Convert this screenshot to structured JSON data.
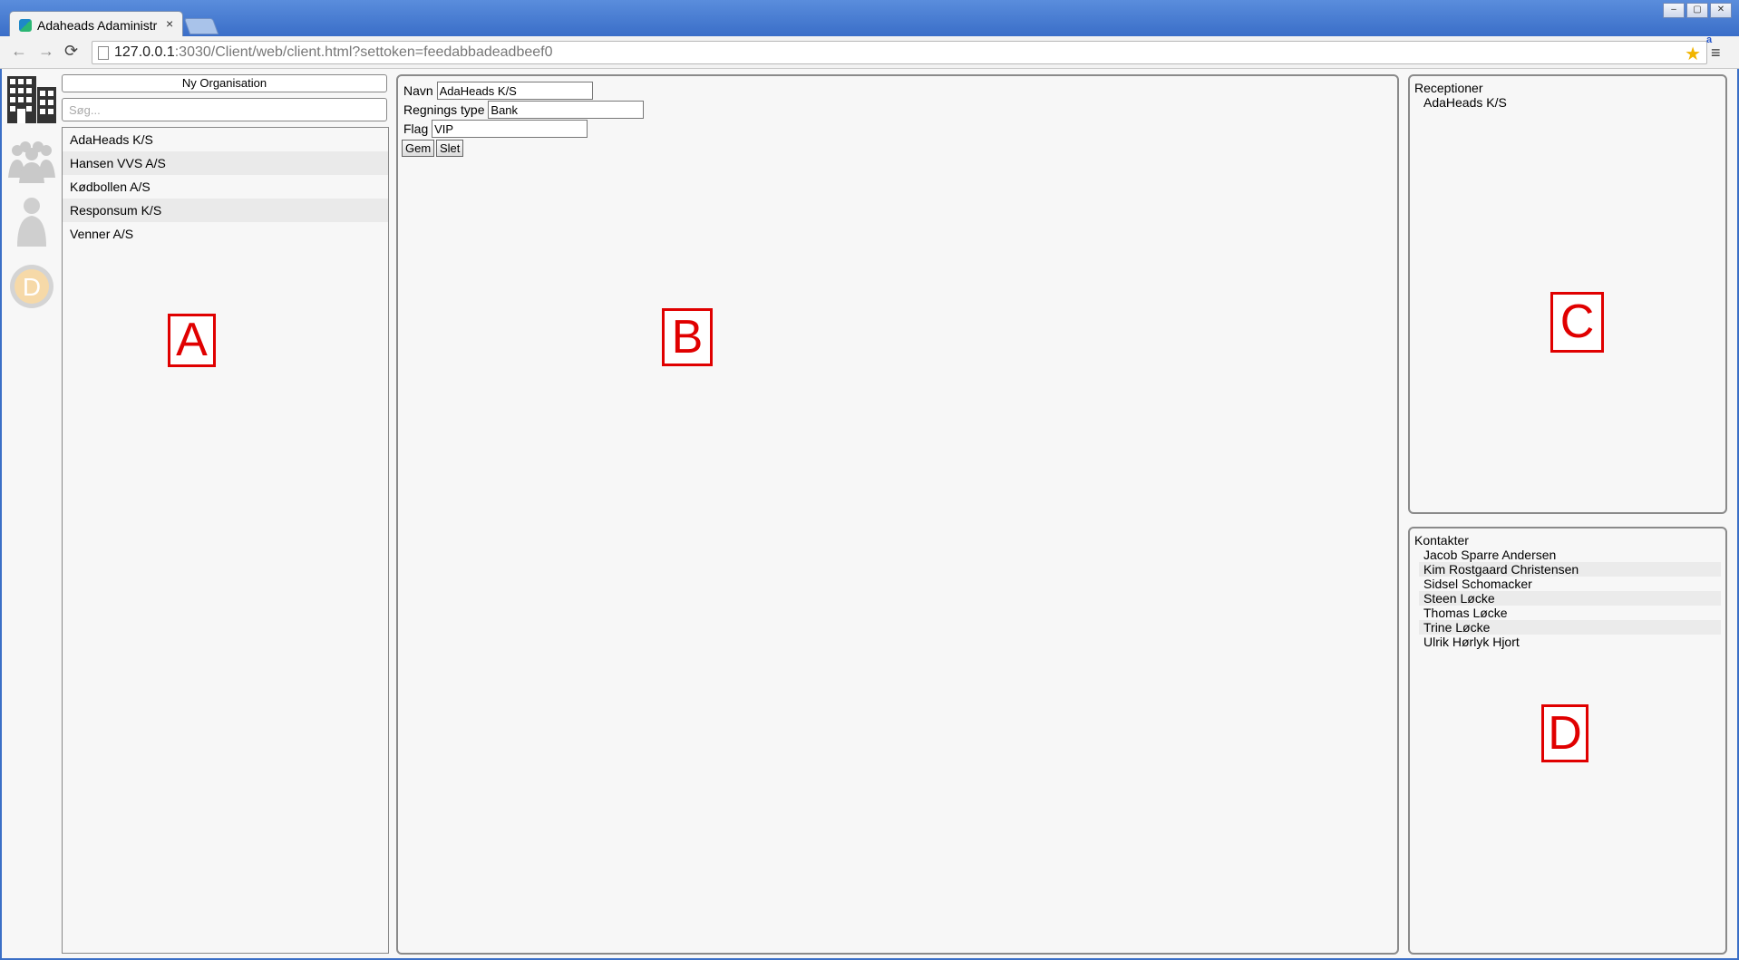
{
  "browser": {
    "tab_title": "Adaheads Adaministr",
    "tab_close": "×",
    "url_host": "127.0.0.1",
    "url_rest": ":3030/Client/web/client.html?settoken=feedabbadeadbeef0",
    "window_buttons": [
      "–",
      "▢",
      "✕"
    ],
    "back": "←",
    "forward": "→",
    "reload": "⟳",
    "star": "★",
    "ext_label": "a",
    "menu": "≡"
  },
  "sidebar_icons": [
    {
      "name": "organisation-icon"
    },
    {
      "name": "receptions-icon"
    },
    {
      "name": "contact-icon"
    },
    {
      "name": "dial-icon"
    }
  ],
  "panelA": {
    "new_button": "Ny Organisation",
    "search_placeholder": "Søg...",
    "items": [
      "AdaHeads K/S",
      "Hansen VVS A/S",
      "Kødbollen A/S",
      "Responsum K/S",
      "Venner A/S"
    ],
    "marker": "A"
  },
  "panelB": {
    "name_label": "Navn",
    "name_value": "AdaHeads K/S",
    "billing_label": "Regnings type",
    "billing_value": "Bank",
    "flag_label": "Flag",
    "flag_value": "VIP",
    "save": "Gem",
    "delete": "Slet",
    "marker": "B"
  },
  "panelC": {
    "title": "Receptioner",
    "items": [
      "AdaHeads K/S"
    ],
    "marker": "C"
  },
  "panelD": {
    "title": "Kontakter",
    "items": [
      "Jacob Sparre Andersen",
      "Kim Rostgaard Christensen",
      "Sidsel Schomacker",
      "Steen Løcke",
      "Thomas Løcke",
      "Trine Løcke",
      "Ulrik Hørlyk Hjort"
    ],
    "marker": "D"
  },
  "colors": {
    "marker": "#e00000",
    "panel_border": "#8a8a8a",
    "titlebar": "#3a6ec8"
  }
}
